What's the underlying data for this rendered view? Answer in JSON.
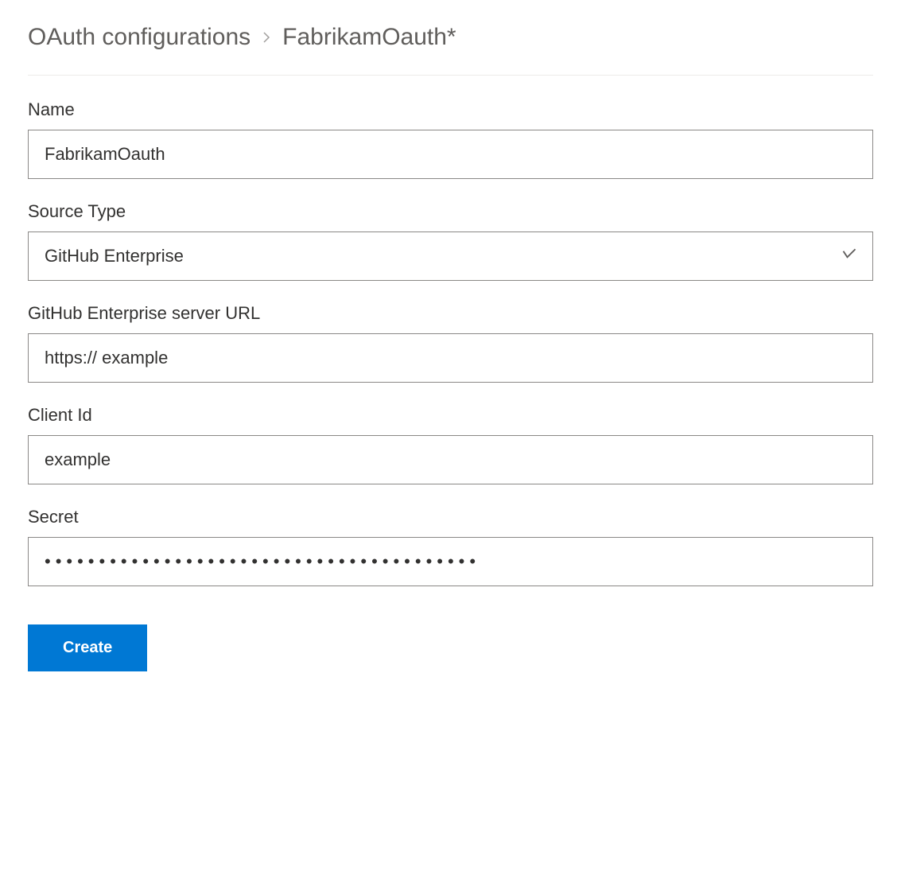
{
  "breadcrumb": {
    "parent": "OAuth configurations",
    "current": "FabrikamOauth*"
  },
  "form": {
    "name": {
      "label": "Name",
      "value": "FabrikamOauth"
    },
    "source_type": {
      "label": "Source Type",
      "value": "GitHub Enterprise"
    },
    "server_url": {
      "label": "GitHub Enterprise server URL",
      "value": "https:// example"
    },
    "client_id": {
      "label": "Client Id",
      "value": "example"
    },
    "secret": {
      "label": "Secret",
      "value": "••••••••••••••••••••••••••••••••••••••••"
    }
  },
  "actions": {
    "create_label": "Create"
  }
}
